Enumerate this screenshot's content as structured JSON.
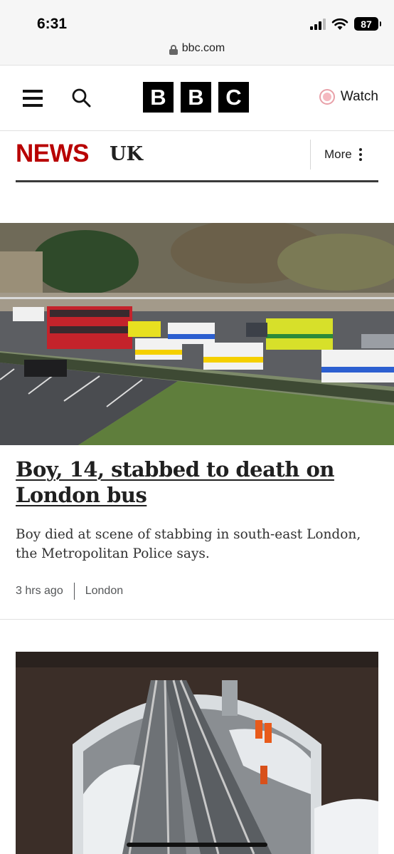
{
  "status_bar": {
    "time": "6:31",
    "battery": "87"
  },
  "browser": {
    "url": "bbc.com"
  },
  "header": {
    "logo_letters": [
      "B",
      "B",
      "C"
    ],
    "watch_label": "Watch",
    "menu_icon": "hamburger-menu-icon",
    "search_icon": "search-icon",
    "watch_icon": "live-dot-icon"
  },
  "news_bar": {
    "brand": "NEWS",
    "section": "UK",
    "more_label": "More",
    "brand_color": "#b80000"
  },
  "article": {
    "headline": "Boy, 14, stabbed to death on London bus",
    "summary": "Boy died at scene of stabbing in south-east London, the Metropolitan Police says.",
    "time_ago": "3 hrs ago",
    "location": "London"
  }
}
